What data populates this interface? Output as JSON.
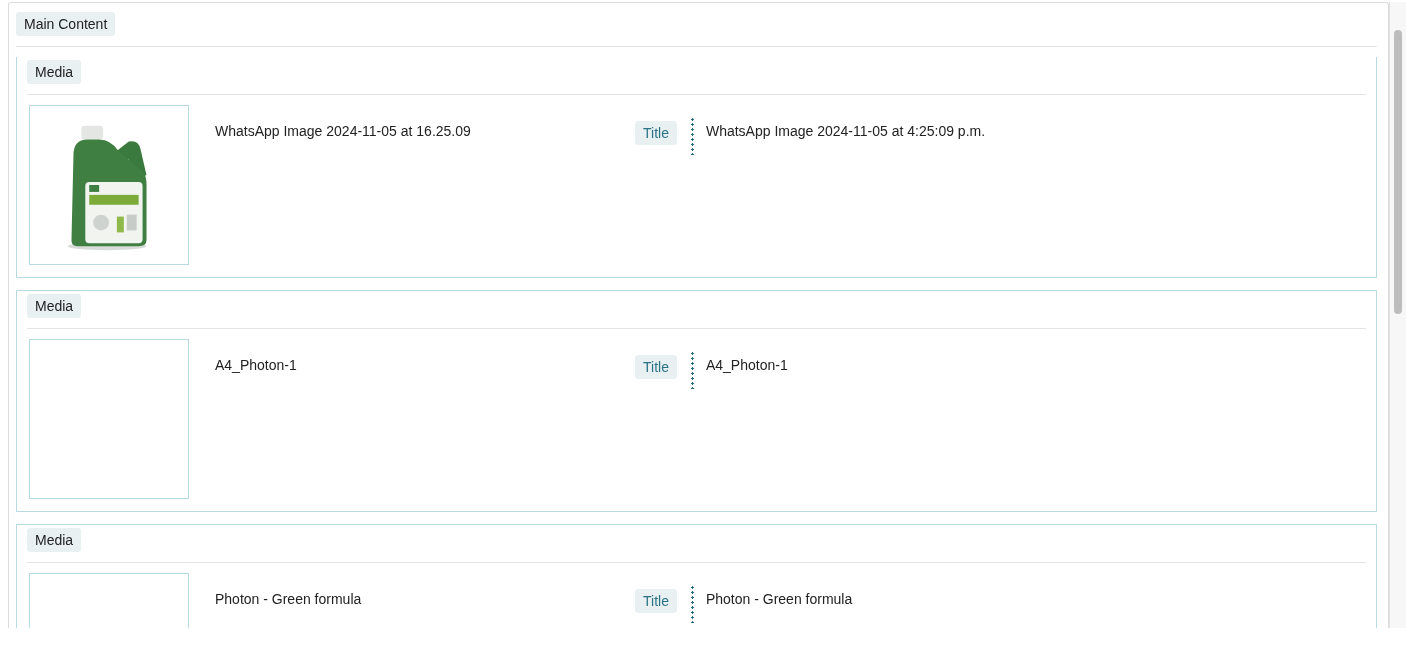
{
  "section": {
    "label": "Main Content"
  },
  "media": [
    {
      "label": "Media",
      "filename": "WhatsApp Image 2024-11-05 at 16.25.09",
      "field_label": "Title",
      "title": "WhatsApp Image 2024-11-05 at 4:25:09 p.m."
    },
    {
      "label": "Media",
      "filename": "A4_Photon-1",
      "field_label": "Title",
      "title": "A4_Photon-1"
    },
    {
      "label": "Media",
      "filename": "Photon - Green formula",
      "field_label": "Title",
      "title": "Photon - Green formula"
    }
  ]
}
